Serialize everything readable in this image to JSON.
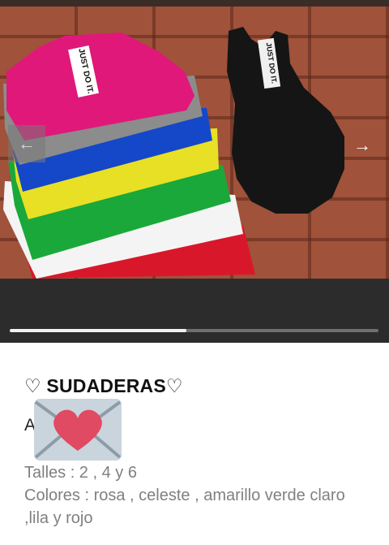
{
  "gallery": {
    "prev_icon": "arrow-left-icon",
    "next_icon": "arrow-right-icon",
    "prev_glyph": "←",
    "next_glyph": "→",
    "progress": 0.48,
    "logo_text": "JUST DO IT.",
    "shirt_colors": [
      "#e0187a",
      "#8c8c8c",
      "#1448c8",
      "#e8e024",
      "#1aa83a",
      "#f4f4f4",
      "#d8182a",
      "#151515"
    ]
  },
  "post": {
    "title": "♡ SUDADERAS♡",
    "line_start": "A",
    "emoji": "love-letter-envelope-icon",
    "sizes": "Talles : 2 , 4 y 6",
    "colors_line": "Colores : rosa , celeste , amarillo  verde claro ,lila y rojo"
  }
}
